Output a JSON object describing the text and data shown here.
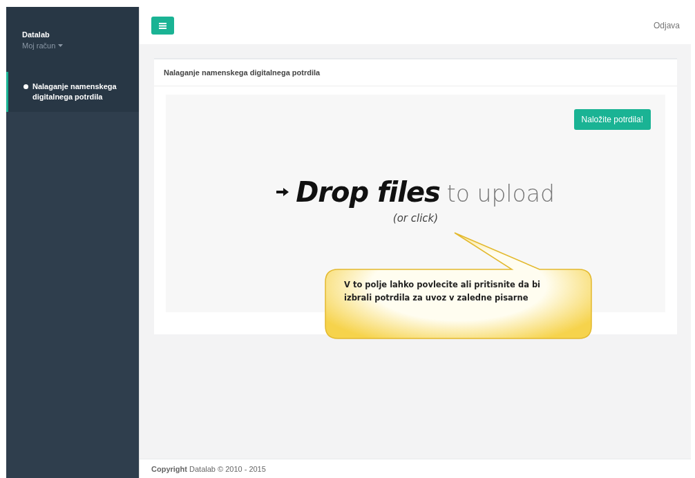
{
  "sidebar": {
    "brand": "Datalab",
    "account": "Moj račun",
    "items": [
      {
        "label": "Nalaganje namenskega digitalnega potrdila",
        "selected": true
      }
    ]
  },
  "topbar": {
    "logout": "Odjava"
  },
  "panel": {
    "title": "Nalaganje namenskega digitalnega potrdila",
    "upload_button": "Naložite potrdila!",
    "dropzone": {
      "strong": "Drop files",
      "light": "to upload",
      "hint": "(or click)"
    }
  },
  "callout": {
    "text": "V to polje lahko povlecite ali pritisnite da bi izbrali potrdila za uvoz v zaledne pisarne"
  },
  "footer": {
    "text": "**Copyright** Datalab © 2010 - 2015"
  }
}
